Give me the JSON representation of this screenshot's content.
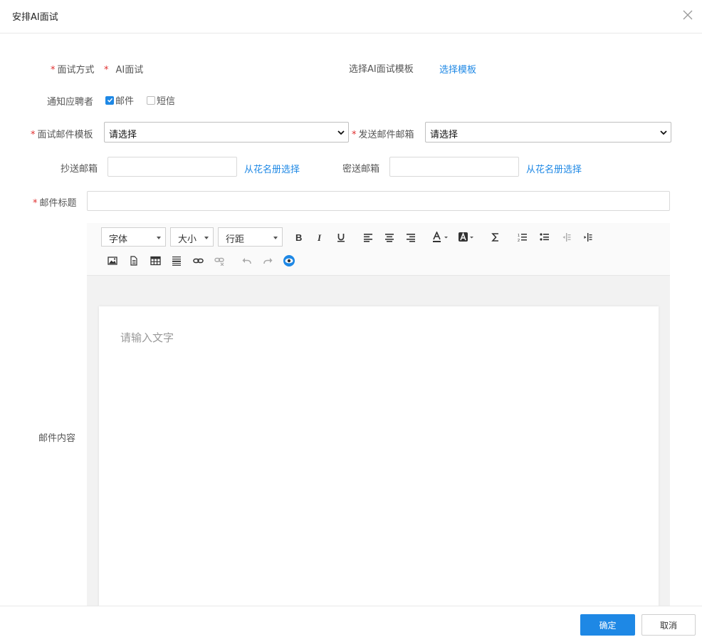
{
  "dialog": {
    "title": "安排AI面试"
  },
  "form": {
    "interview_mode": {
      "label": "面试方式",
      "required_mark": "*",
      "value_marker": "*",
      "value": "AI面试"
    },
    "ai_template": {
      "label": "选择AI面试模板",
      "link": "选择模板"
    },
    "notify": {
      "label": "通知应聘者",
      "options": [
        {
          "label": "邮件",
          "checked": true
        },
        {
          "label": "短信",
          "checked": false
        }
      ]
    },
    "email_template": {
      "label": "面试邮件模板",
      "required_mark": "*",
      "value": "请选择"
    },
    "sender_email": {
      "label": "发送邮件邮箱",
      "required_mark": "*",
      "value": "请选择"
    },
    "cc": {
      "label": "抄送邮箱",
      "value": "",
      "link": "从花名册选择"
    },
    "bcc": {
      "label": "密送邮箱",
      "value": "",
      "link": "从花名册选择"
    },
    "subject": {
      "label": "邮件标题",
      "required_mark": "*",
      "value": ""
    },
    "content": {
      "label": "邮件内容"
    }
  },
  "editor": {
    "font_family": "字体",
    "font_size": "大小",
    "line_height": "行距",
    "placeholder": "请输入文字",
    "tools_row1": [
      "bold-icon",
      "italic-icon",
      "underline-icon",
      "align-left-icon",
      "align-center-icon",
      "align-right-icon",
      "font-color-icon",
      "background-color-icon",
      "formula-icon",
      "ordered-list-icon",
      "unordered-list-icon",
      "outdent-icon",
      "indent-icon"
    ],
    "tools_row2": [
      "image-icon",
      "file-icon",
      "table-icon",
      "divider-icon",
      "link-icon",
      "unlink-icon",
      "undo-icon",
      "redo-icon",
      "preview-icon"
    ]
  },
  "footer": {
    "confirm": "确定",
    "cancel": "取消"
  },
  "colors": {
    "accent": "#1e88e5",
    "required": "#e03030"
  }
}
